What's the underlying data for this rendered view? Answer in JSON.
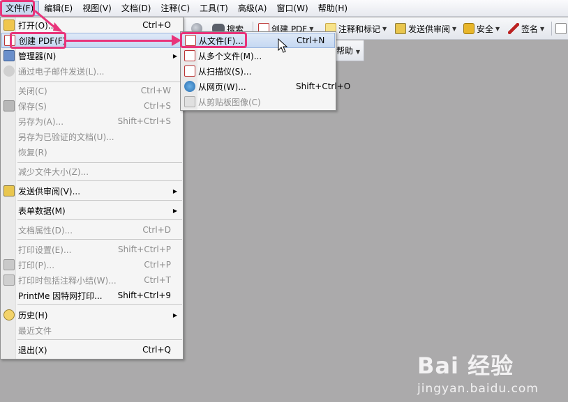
{
  "menubar": {
    "items": [
      "文件(F)",
      "编辑(E)",
      "视图(V)",
      "文档(D)",
      "注释(C)",
      "工具(T)",
      "高级(A)",
      "窗口(W)",
      "帮助(H)"
    ]
  },
  "toolbar": {
    "search": "搜索",
    "create_pdf": "创建 PDF",
    "comment": "注释和标记",
    "send_review": "发送供审阅",
    "security": "安全",
    "sign": "签名",
    "help": "帮助"
  },
  "filemenu": {
    "open": {
      "label": "打开(O)...",
      "shortcut": "Ctrl+O"
    },
    "create_pdf": {
      "label": "创建 PDF(F)"
    },
    "organizer": {
      "label": "管理器(N)"
    },
    "email": {
      "label": "通过电子邮件发送(L)..."
    },
    "close": {
      "label": "关闭(C)",
      "shortcut": "Ctrl+W"
    },
    "save": {
      "label": "保存(S)",
      "shortcut": "Ctrl+S"
    },
    "save_as": {
      "label": "另存为(A)...",
      "shortcut": "Shift+Ctrl+S"
    },
    "save_certified": {
      "label": "另存为已验证的文档(U)..."
    },
    "revert": {
      "label": "恢复(R)"
    },
    "reduce_size": {
      "label": "减少文件大小(Z)..."
    },
    "send_review": {
      "label": "发送供审阅(V)..."
    },
    "form_data": {
      "label": "表单数据(M)"
    },
    "properties": {
      "label": "文档属性(D)...",
      "shortcut": "Ctrl+D"
    },
    "print_setup": {
      "label": "打印设置(E)...",
      "shortcut": "Shift+Ctrl+P"
    },
    "print": {
      "label": "打印(P)...",
      "shortcut": "Ctrl+P"
    },
    "print_summary": {
      "label": "打印时包括注释小结(W)...",
      "shortcut": "Ctrl+T"
    },
    "printme": {
      "label": "PrintMe 因特网打印...",
      "shortcut": "Shift+Ctrl+9"
    },
    "history": {
      "label": "历史(H)"
    },
    "recent": {
      "label": "最近文件"
    },
    "exit": {
      "label": "退出(X)",
      "shortcut": "Ctrl+Q"
    }
  },
  "submenu": {
    "from_file": {
      "label": "从文件(F)...",
      "shortcut": "Ctrl+N"
    },
    "from_multiple": {
      "label": "从多个文件(M)..."
    },
    "from_scanner": {
      "label": "从扫描仪(S)..."
    },
    "from_web": {
      "label": "从网页(W)...",
      "shortcut": "Shift+Ctrl+O"
    },
    "from_clipboard": {
      "label": "从剪贴板图像(C)"
    }
  },
  "watermark": {
    "brand": "Bai 经验",
    "url": "jingyan.baidu.com"
  },
  "colors": {
    "annotation": "#e8347a",
    "highlight": "#c5d8f2",
    "background": "#abaaab"
  }
}
